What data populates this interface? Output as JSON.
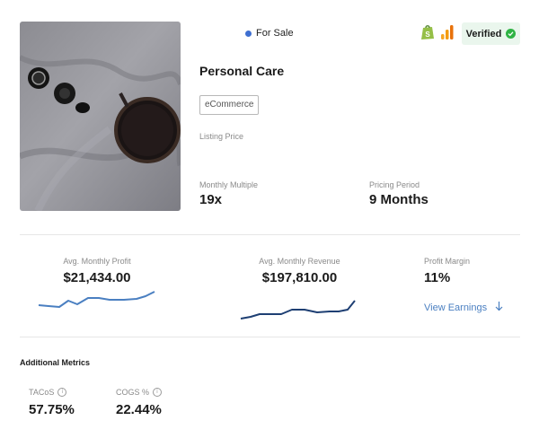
{
  "listing": {
    "status": "For Sale",
    "verified_label": "Verified",
    "title": "Personal Care",
    "tag": "eCommerce",
    "listing_price_label": "Listing Price"
  },
  "icons": {
    "status_dot": "status-dot-icon",
    "shopify": "shopify-icon",
    "analytics": "analytics-icon",
    "verified": "check-circle-icon",
    "info": "info-icon",
    "arrow": "arrow-down-icon"
  },
  "colors": {
    "status_dot": "#3e6fd1",
    "verified_bg": "#eaf6ed",
    "verified_check": "#2fb344",
    "profit_line": "#4a7fc1",
    "revenue_line": "#1e3f73",
    "link": "#4a7fc1"
  },
  "stats": {
    "monthly_multiple_label": "Monthly Multiple",
    "monthly_multiple_value": "19x",
    "pricing_period_label": "Pricing Period",
    "pricing_period_value": "9 Months"
  },
  "earnings": {
    "profit_label": "Avg. Monthly Profit",
    "profit_value": "$21,434.00",
    "revenue_label": "Avg. Monthly Revenue",
    "revenue_value": "$197,810.00",
    "margin_label": "Profit Margin",
    "margin_value": "11%",
    "view_earnings_label": "View Earnings"
  },
  "additional": {
    "title": "Additional Metrics",
    "tacos_label": "TACoS",
    "tacos_value": "57.75%",
    "cogs_label": "COGS %",
    "cogs_value": "22.44%"
  }
}
